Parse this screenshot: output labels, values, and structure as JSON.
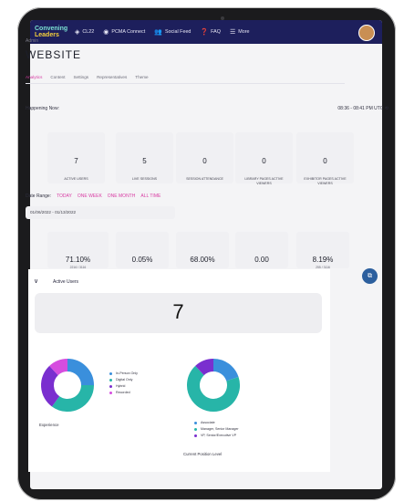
{
  "nav": {
    "logo_line1": "Convening",
    "logo_line2": "Leaders",
    "items": [
      {
        "icon": "diamond-icon",
        "glyph": "◈",
        "label": "CL22"
      },
      {
        "icon": "target-icon",
        "glyph": "◉",
        "label": "PCMA Connect"
      },
      {
        "icon": "people-icon",
        "glyph": "👥",
        "label": "Social Feed"
      },
      {
        "icon": "help-icon",
        "glyph": "❓",
        "label": "FAQ"
      },
      {
        "icon": "menu-icon",
        "glyph": "☰",
        "label": "More"
      }
    ]
  },
  "header": {
    "breadcrumb": "Admin",
    "title": "WEBSITE"
  },
  "tabs": [
    "Analytics",
    "Content",
    "Settings",
    "Representatives",
    "Theme"
  ],
  "happening": {
    "label": "Happening Now:",
    "time": "08:36 - 08:41 PM UTC",
    "refresh_icon": "refresh-icon",
    "cards": [
      {
        "value": "7",
        "label": "ACTIVE USERS"
      },
      {
        "value": "5",
        "label": "LIVE SESSIONS"
      },
      {
        "value": "0",
        "label": "SESSION ATTENDANCE"
      },
      {
        "value": "0",
        "label": "LIBRARY PAGES ACTIVE VIEWERS"
      },
      {
        "value": "0",
        "label": "EXHIBITOR PAGES ACTIVE VIEWERS"
      }
    ]
  },
  "date_range": {
    "label": "Date Range:",
    "options": [
      "TODAY",
      "ONE WEEK",
      "ONE MONTH",
      "ALL TIME"
    ],
    "value": "01/06/2022 - 01/13/2022"
  },
  "stats": [
    {
      "value": "71.10%",
      "sub": "2216 / 3116"
    },
    {
      "value": "0.05%",
      "sub": ""
    },
    {
      "value": "68.00%",
      "sub": ""
    },
    {
      "value": "0.00",
      "sub": ""
    },
    {
      "value": "8.19%",
      "sub": "255 / 3116"
    }
  ],
  "active_users": {
    "title": "Active Users",
    "value": "7"
  },
  "colors": {
    "blue": "#3a8fdc",
    "teal": "#27b5a8",
    "purple": "#7a2fcf",
    "pink": "#d64ddf"
  },
  "chart_data": [
    {
      "type": "pie",
      "title": "Experience",
      "categories": [
        "In-Person Only",
        "Digital Only",
        "Hybrid",
        "Recorded"
      ],
      "values": [
        25,
        35,
        28,
        12
      ]
    },
    {
      "type": "pie",
      "title": "Current Position Level",
      "categories": [
        "Associate",
        "Manager, Senior Manager",
        "VP, Senior/Executive VP"
      ],
      "values": [
        20,
        68,
        12
      ]
    }
  ]
}
